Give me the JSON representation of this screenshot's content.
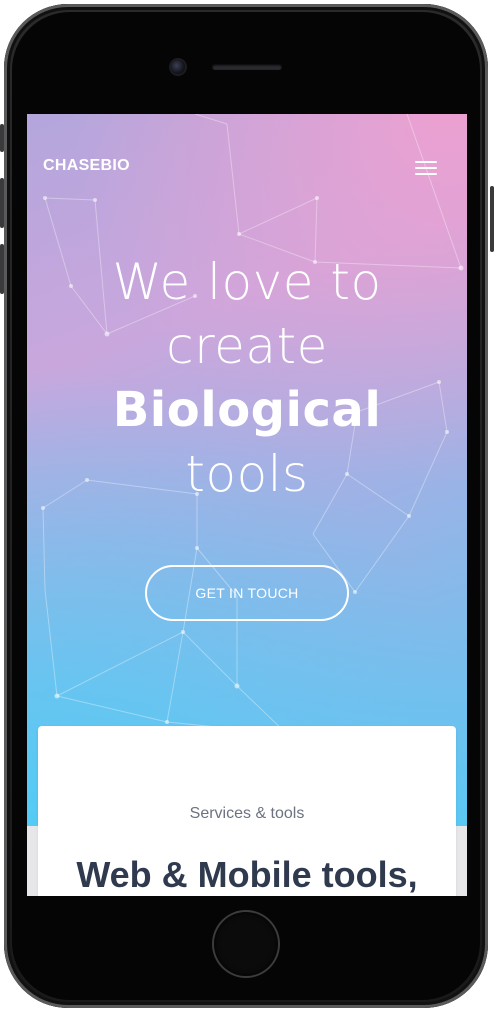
{
  "navbar": {
    "brand": "CHASEBIO",
    "menu_icon": "hamburger-menu-icon"
  },
  "hero": {
    "headline_lines": [
      "We love to",
      "create",
      "Biological",
      "tools"
    ],
    "cta_label": "GET IN TOUCH"
  },
  "services": {
    "eyebrow": "Services & tools",
    "title": "Web & Mobile tools,"
  },
  "colors": {
    "gradient_top_right": "#f0a0d0",
    "gradient_mid": "#b3a6dc",
    "gradient_bottom_left": "#50cdf5",
    "title_text": "#2f3a4f",
    "eyebrow_text": "#6b7280"
  }
}
